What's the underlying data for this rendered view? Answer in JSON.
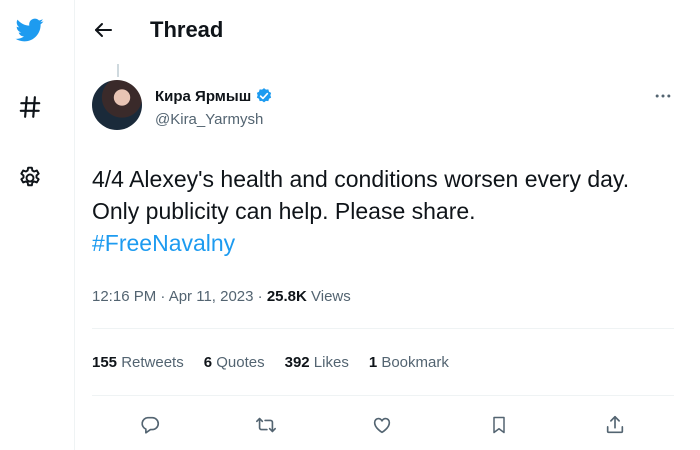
{
  "header": {
    "title": "Thread"
  },
  "tweet": {
    "display_name": "Кира Ярмыш",
    "handle": "@Kira_Yarmysh",
    "text_line1": "4/4 Alexey's health and conditions worsen every day.",
    "text_line2": "Only publicity can help. Please share.",
    "hashtag": "#FreeNavalny",
    "time": "12:16 PM · Apr 11, 2023 · ",
    "views_count": "25.8K",
    "views_label": " Views"
  },
  "stats": {
    "retweets_count": "155",
    "retweets_label": " Retweets",
    "quotes_count": "6",
    "quotes_label": " Quotes",
    "likes_count": "392",
    "likes_label": " Likes",
    "bookmarks_count": "1",
    "bookmarks_label": " Bookmark"
  },
  "icons": {
    "sidebar": [
      "twitter-logo-icon",
      "hashtag-icon",
      "settings-icon"
    ],
    "header": [
      "back-arrow-icon"
    ],
    "actions": [
      "reply-icon",
      "retweet-icon",
      "like-icon",
      "bookmark-icon",
      "share-icon"
    ],
    "badge": "verified-badge-icon",
    "more": "more-icon"
  },
  "colors": {
    "accent": "#1d9bf0",
    "text": "#0f1419",
    "secondary": "#536471"
  }
}
